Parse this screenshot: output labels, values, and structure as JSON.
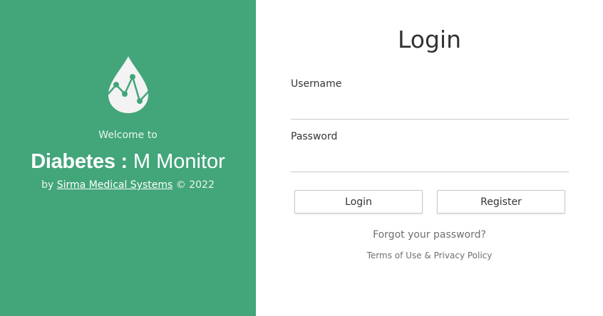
{
  "brand_panel": {
    "welcome": "Welcome to",
    "brand_bold": "Diabetes :",
    "brand_light": " M Monitor",
    "by_prefix": "by",
    "company": "Sirma Medical Systems",
    "copyright": "© 2022",
    "logo_icon": "blood-drop-chart-icon",
    "background_color": "#43a57a"
  },
  "login_form": {
    "title": "Login",
    "username_label": "Username",
    "username_value": "",
    "password_label": "Password",
    "password_value": "",
    "login_button": "Login",
    "register_button": "Register",
    "forgot_password": "Forgot your password?",
    "terms": "Terms of Use",
    "ampersand": "&",
    "privacy": "Privacy Policy"
  }
}
